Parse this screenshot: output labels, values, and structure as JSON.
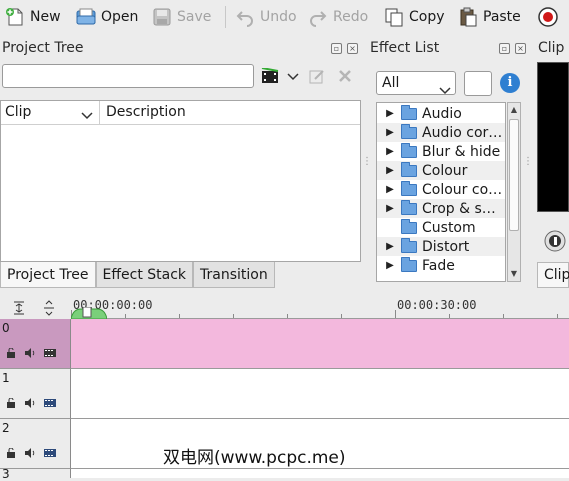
{
  "toolbar": {
    "new": "New",
    "open": "Open",
    "save": "Save",
    "undo": "Undo",
    "redo": "Redo",
    "copy": "Copy",
    "paste": "Paste"
  },
  "project_tree": {
    "title": "Project Tree",
    "search_value": "",
    "columns": [
      "Clip",
      "Description"
    ]
  },
  "tabs": [
    "Project Tree",
    "Effect Stack",
    "Transition"
  ],
  "effect_list": {
    "title": "Effect List",
    "filter": "All",
    "info": "i",
    "items": [
      {
        "label": "Audio",
        "expandable": true
      },
      {
        "label": "Audio cor…",
        "expandable": true
      },
      {
        "label": "Blur & hide",
        "expandable": true
      },
      {
        "label": "Colour",
        "expandable": true
      },
      {
        "label": "Colour co…",
        "expandable": true
      },
      {
        "label": "Crop & s…",
        "expandable": true
      },
      {
        "label": "Custom",
        "expandable": false
      },
      {
        "label": "Distort",
        "expandable": true
      },
      {
        "label": "Fade",
        "expandable": true
      }
    ]
  },
  "clip_monitor": {
    "title": "Clip M",
    "tab": "Clip"
  },
  "timeline": {
    "ruler_labels": [
      "00:00:00:00",
      "00:00:30:00"
    ],
    "tracks": [
      {
        "number": "0",
        "selected": true
      },
      {
        "number": "1",
        "selected": false
      },
      {
        "number": "2",
        "selected": false
      },
      {
        "number": "3",
        "selected": false
      }
    ]
  },
  "watermark": "双电网(www.pcpc.me)"
}
